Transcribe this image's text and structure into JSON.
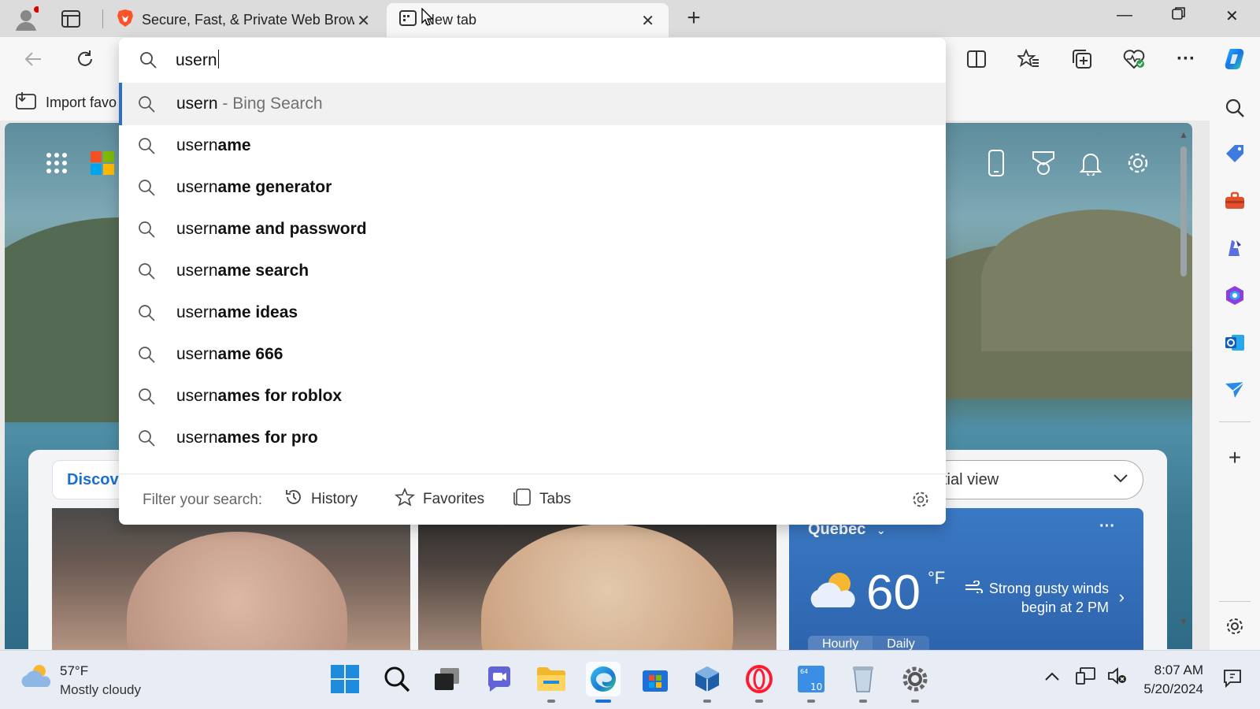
{
  "tabs": [
    {
      "title": "Secure, Fast, & Private Web Brow",
      "active": false
    },
    {
      "title": "New tab",
      "active": true
    }
  ],
  "address": {
    "query": "usern"
  },
  "suggestions": [
    {
      "typed": "usern",
      "suffix": "",
      "engine": " - Bing Search",
      "selected": true
    },
    {
      "typed": "usern",
      "suffix": "ame",
      "engine": "",
      "selected": false
    },
    {
      "typed": "usern",
      "suffix": "ame generator",
      "engine": "",
      "selected": false
    },
    {
      "typed": "usern",
      "suffix": "ame and password",
      "engine": "",
      "selected": false
    },
    {
      "typed": "usern",
      "suffix": "ame search",
      "engine": "",
      "selected": false
    },
    {
      "typed": "usern",
      "suffix": "ame ideas",
      "engine": "",
      "selected": false
    },
    {
      "typed": "usern",
      "suffix": "ame 666",
      "engine": "",
      "selected": false
    },
    {
      "typed": "usern",
      "suffix": "ames for roblox",
      "engine": "",
      "selected": false
    },
    {
      "typed": "usern",
      "suffix": "ames for pro",
      "engine": "",
      "selected": false
    }
  ],
  "filter": {
    "label": "Filter your search:",
    "history": "History",
    "favorites": "Favorites",
    "tabs": "Tabs"
  },
  "favorites_bar": {
    "import_label": "Import favo"
  },
  "newtab": {
    "discover_label": "Discov",
    "view_selector": "tial view"
  },
  "weather_card": {
    "location": "Québec",
    "temp": "60",
    "unit": "°F",
    "alert_line1": "Strong gusty winds",
    "alert_line2": "begin at 2 PM",
    "tab_hourly": "Hourly",
    "tab_daily": "Daily"
  },
  "taskbar": {
    "weather_temp": "57°F",
    "weather_desc": "Mostly cloudy",
    "time": "8:07 AM",
    "date": "5/20/2024"
  },
  "colors": {
    "accent": "#2b6fc7",
    "brave": "#fb542b",
    "weather_card": "#3a79c4"
  }
}
